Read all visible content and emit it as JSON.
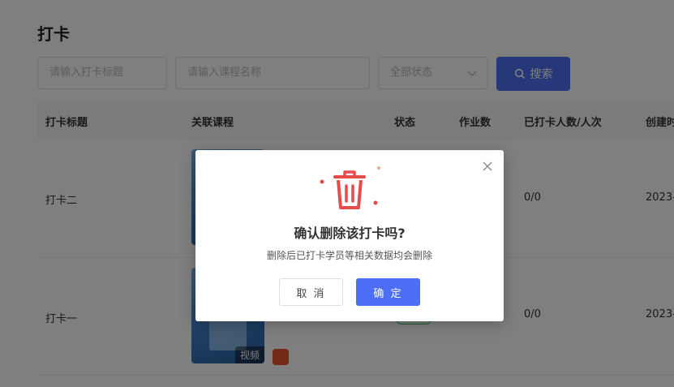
{
  "page": {
    "title": "打卡"
  },
  "filters": {
    "title_placeholder": "请输入打卡标题",
    "course_placeholder": "请输入课程名称",
    "status_value": "全部状态",
    "search_label": "搜索"
  },
  "table": {
    "columns": [
      "打卡标题",
      "关联课程",
      "状态",
      "作业数",
      "已打卡人数/人次",
      "创建时间"
    ],
    "rows": [
      {
        "title": "打卡二",
        "checkins": "0/0",
        "created": "2023-"
      },
      {
        "title": "打卡一",
        "checkins": "0/0",
        "created": "2023-",
        "thumb_tag": "视频"
      }
    ]
  },
  "dialog": {
    "title": "确认删除该打卡吗?",
    "message": "删除后已打卡学员等相关数据均会删除",
    "cancel_label": "取 消",
    "confirm_label": "确 定"
  },
  "colors": {
    "primary": "#4c6ef5",
    "danger": "#e94b4b",
    "overlay": "rgba(0,0,0,0.5)"
  },
  "icons": [
    "chevron-down-icon",
    "search-icon",
    "trash-icon",
    "close-icon",
    "member-icon"
  ]
}
